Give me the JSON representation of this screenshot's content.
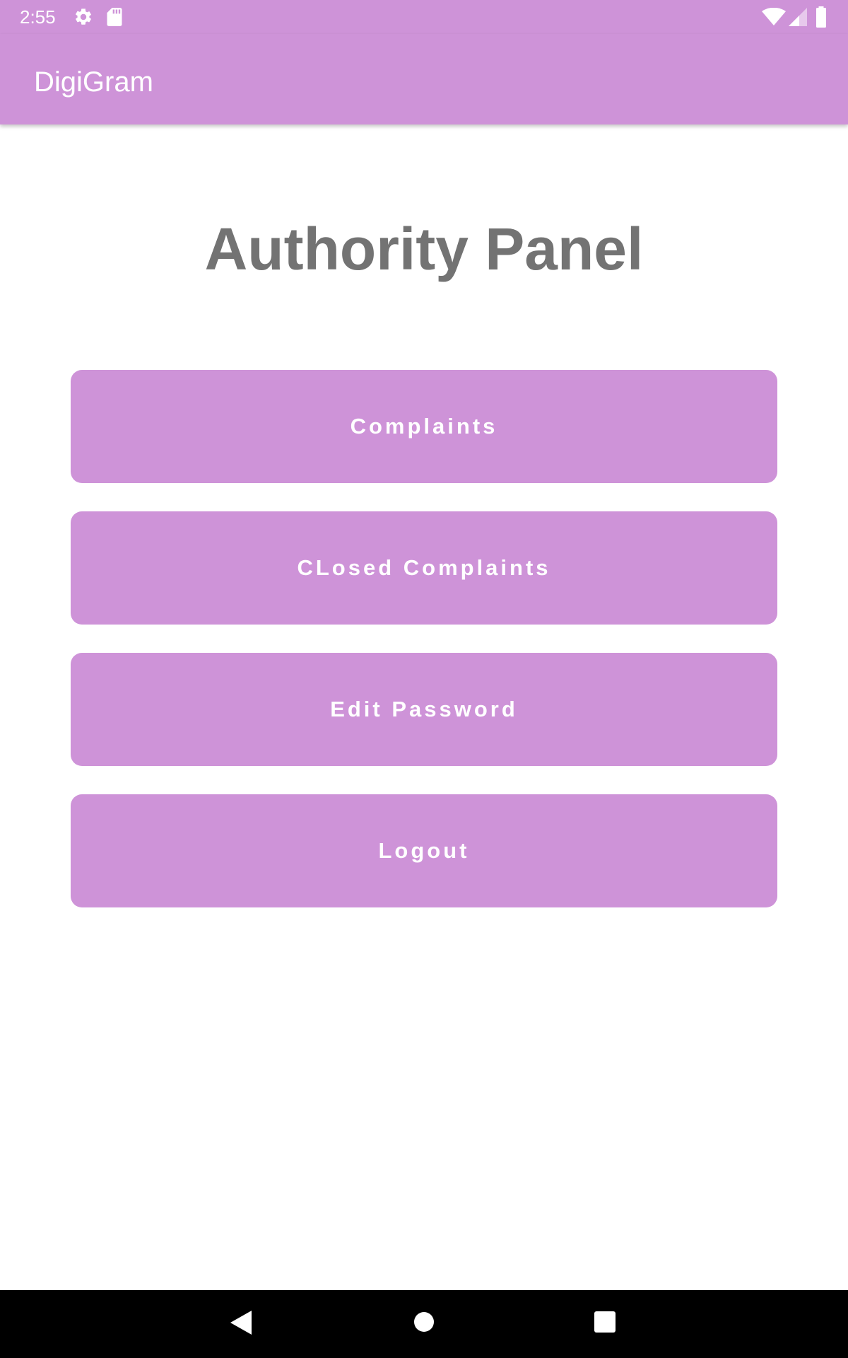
{
  "status_bar": {
    "time": "2:55",
    "icons": [
      "gear-icon",
      "sd-card-icon",
      "wifi-icon",
      "signal-icon",
      "battery-icon"
    ]
  },
  "app_bar": {
    "title": "DigiGram"
  },
  "main": {
    "title": "Authority Panel",
    "buttons": [
      {
        "label": "Complaints"
      },
      {
        "label": "CLosed Complaints"
      },
      {
        "label": "Edit Password"
      },
      {
        "label": "Logout"
      }
    ]
  },
  "nav_bar": {
    "icons": [
      "back-icon",
      "home-icon",
      "recents-icon"
    ]
  },
  "colors": {
    "accent": "#ce93d8",
    "title_text": "#737373",
    "background": "#ffffff",
    "nav_bar": "#000000"
  }
}
